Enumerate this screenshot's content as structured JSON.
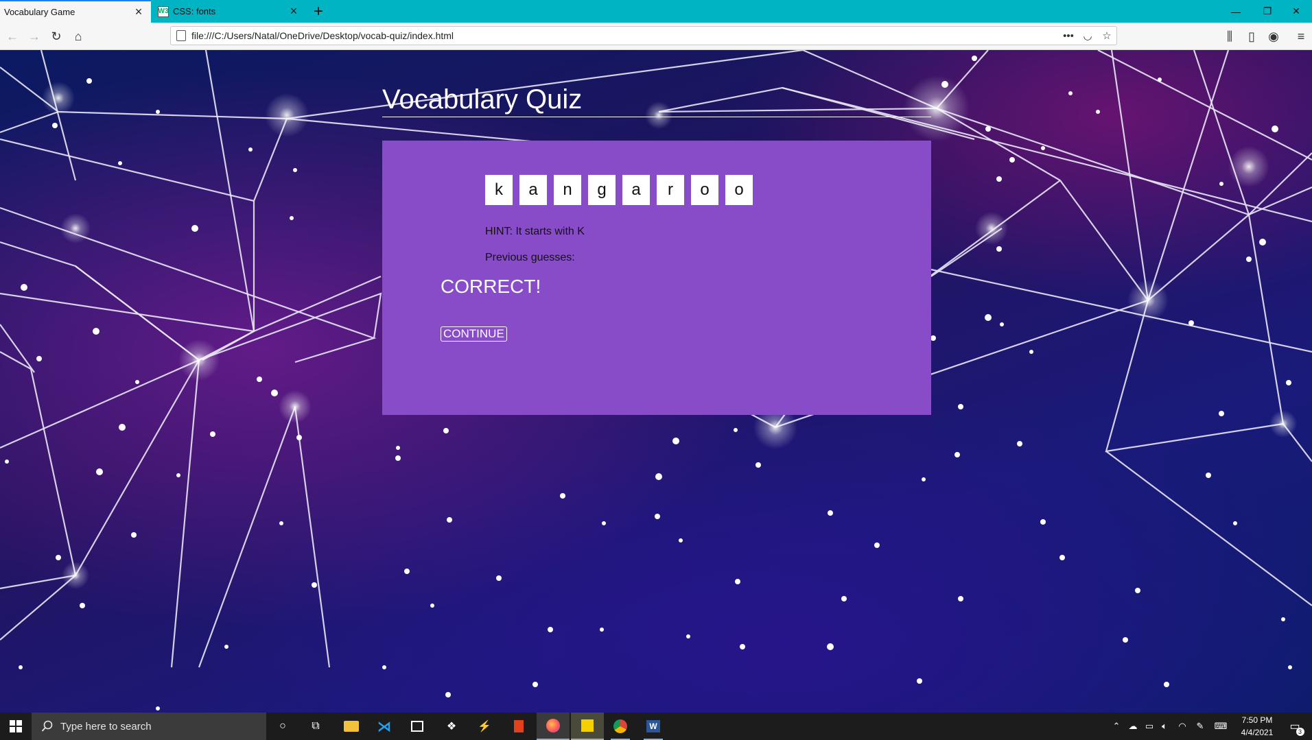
{
  "browser": {
    "tabs": [
      {
        "label": "Vocabulary Game",
        "active": true
      },
      {
        "label": "CSS: fonts",
        "favicon_text": "W3",
        "active": false
      }
    ],
    "url": "file:///C:/Users/Natal/OneDrive/Desktop/vocab-quiz/index.html",
    "accent_color": "#00b4c4"
  },
  "quiz": {
    "title": "Vocabulary Quiz",
    "letters": [
      "k",
      "a",
      "n",
      "g",
      "a",
      "r",
      "o",
      "o"
    ],
    "hint": "HINT: It starts with K",
    "previous_guesses_label": "Previous guesses:",
    "result": "CORRECT!",
    "continue_label": "CONTINUE",
    "card_color": "#884cc9"
  },
  "taskbar": {
    "search_placeholder": "Type here to search",
    "time": "7:50 PM",
    "date": "4/4/2021",
    "notification_count": "3",
    "apps": [
      "cortana-icon",
      "task-view-icon",
      "file-explorer-icon",
      "vscode-icon",
      "store-icon",
      "dropbox-icon",
      "app-icon",
      "office-icon",
      "firefox-icon",
      "sticky-notes-icon",
      "chrome-icon",
      "word-icon"
    ]
  }
}
